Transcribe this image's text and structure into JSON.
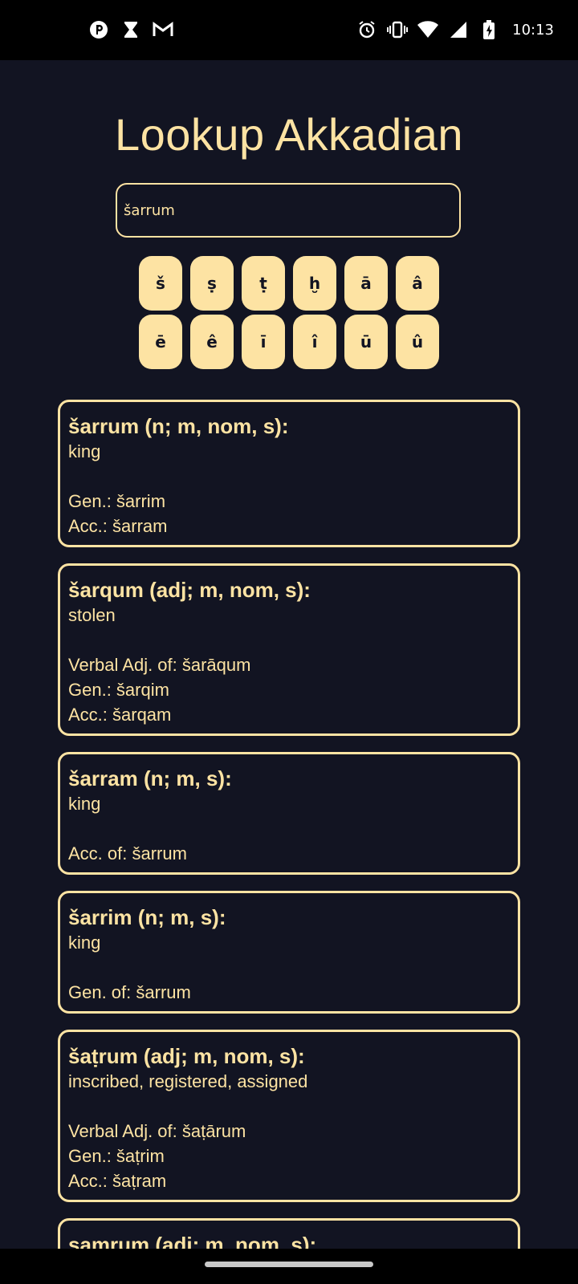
{
  "status_bar": {
    "time": "10:13",
    "left_icons": [
      "app-p-icon",
      "hourglass-icon",
      "gmail-icon"
    ],
    "right_icons": [
      "alarm-icon",
      "vibrate-icon",
      "wifi-icon",
      "signal-icon",
      "battery-charging-icon"
    ]
  },
  "app": {
    "title": "Lookup Akkadian"
  },
  "search": {
    "value": "šarrum"
  },
  "keyboard": {
    "row1": [
      "š",
      "ṣ",
      "ṭ",
      "ḫ",
      "ā",
      "â"
    ],
    "row2": [
      "ē",
      "ê",
      "ī",
      "î",
      "ū",
      "û"
    ]
  },
  "results": [
    {
      "head": "šarrum (n; m, nom, s):",
      "definition": "king",
      "details": [
        "Gen.: šarrim",
        "Acc.: šarram"
      ]
    },
    {
      "head": "šarqum (adj; m, nom, s):",
      "definition": "stolen",
      "details": [
        "Verbal Adj. of: šarāqum",
        "Gen.: šarqim",
        "Acc.: šarqam"
      ]
    },
    {
      "head": "šarram (n; m, s):",
      "definition": "king",
      "details": [
        "Acc. of: šarrum"
      ]
    },
    {
      "head": "šarrim (n; m, s):",
      "definition": "king",
      "details": [
        "Gen. of: šarrum"
      ]
    },
    {
      "head": "šaṭrum (adj; m, nom, s):",
      "definition": "inscribed, registered, assigned",
      "details": [
        "Verbal Adj. of: šaṭārum",
        "Gen.: šaṭrim",
        "Acc.: šaṭram"
      ]
    },
    {
      "head": "ṣamrum (adj; m, nom, s):",
      "definition": "",
      "details": []
    }
  ]
}
